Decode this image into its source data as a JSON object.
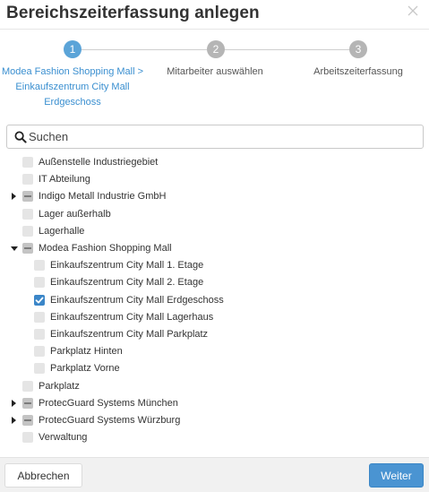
{
  "dialog": {
    "title": "Bereichszeiterfassung anlegen",
    "close_icon": "close-icon"
  },
  "stepper": {
    "steps": [
      {
        "number": "1",
        "state": "active",
        "label_lines": [
          "Modea Fashion Shopping Mall >",
          "Einkaufszentrum City Mall",
          "Erdgeschoss"
        ]
      },
      {
        "number": "2",
        "state": "inactive",
        "label_lines": [
          "Mitarbeiter auswählen"
        ]
      },
      {
        "number": "3",
        "state": "inactive",
        "label_lines": [
          "Arbeitszeiterfassung"
        ]
      }
    ]
  },
  "search": {
    "placeholder": "Suchen",
    "value": "",
    "icon": "search-icon"
  },
  "tree": {
    "items": [
      {
        "label": "Außenstelle Industriegebiet",
        "level": 0,
        "expandable": false,
        "expanded": false,
        "state": "unchecked"
      },
      {
        "label": "IT Abteilung",
        "level": 0,
        "expandable": false,
        "expanded": false,
        "state": "unchecked"
      },
      {
        "label": "Indigo Metall Industrie GmbH",
        "level": 0,
        "expandable": true,
        "expanded": false,
        "state": "partial"
      },
      {
        "label": "Lager außerhalb",
        "level": 0,
        "expandable": false,
        "expanded": false,
        "state": "unchecked"
      },
      {
        "label": "Lagerhalle",
        "level": 0,
        "expandable": false,
        "expanded": false,
        "state": "unchecked"
      },
      {
        "label": "Modea Fashion Shopping Mall",
        "level": 0,
        "expandable": true,
        "expanded": true,
        "state": "partial"
      },
      {
        "label": "Einkaufszentrum City Mall 1. Etage",
        "level": 1,
        "expandable": false,
        "expanded": false,
        "state": "unchecked"
      },
      {
        "label": "Einkaufszentrum City Mall 2. Etage",
        "level": 1,
        "expandable": false,
        "expanded": false,
        "state": "unchecked"
      },
      {
        "label": "Einkaufszentrum City Mall Erdgeschoss",
        "level": 1,
        "expandable": false,
        "expanded": false,
        "state": "checked"
      },
      {
        "label": "Einkaufszentrum City Mall Lagerhaus",
        "level": 1,
        "expandable": false,
        "expanded": false,
        "state": "unchecked"
      },
      {
        "label": "Einkaufszentrum City Mall Parkplatz",
        "level": 1,
        "expandable": false,
        "expanded": false,
        "state": "unchecked"
      },
      {
        "label": "Parkplatz Hinten",
        "level": 1,
        "expandable": false,
        "expanded": false,
        "state": "unchecked"
      },
      {
        "label": "Parkplatz Vorne",
        "level": 1,
        "expandable": false,
        "expanded": false,
        "state": "unchecked"
      },
      {
        "label": "Parkplatz",
        "level": 0,
        "expandable": false,
        "expanded": false,
        "state": "unchecked"
      },
      {
        "label": "ProtecGuard Systems München",
        "level": 0,
        "expandable": true,
        "expanded": false,
        "state": "partial"
      },
      {
        "label": "ProtecGuard Systems Würzburg",
        "level": 0,
        "expandable": true,
        "expanded": false,
        "state": "partial"
      },
      {
        "label": "Verwaltung",
        "level": 0,
        "expandable": false,
        "expanded": false,
        "state": "unchecked"
      }
    ]
  },
  "footer": {
    "cancel_label": "Abbrechen",
    "next_label": "Weiter"
  },
  "colors": {
    "accent": "#4a94d2",
    "step_active": "#5ba4d8",
    "step_inactive": "#b5b5b5",
    "checkbox_checked": "#3b86c8"
  }
}
